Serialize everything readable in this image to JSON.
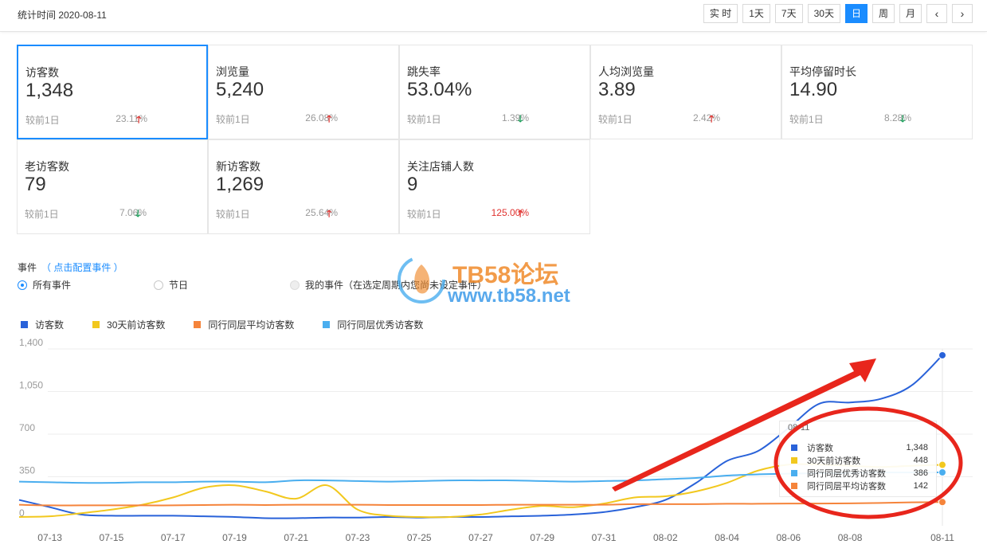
{
  "header": {
    "stat_time": "统计时间 2020-08-11",
    "ranges": [
      "实 时",
      "1天",
      "7天",
      "30天",
      "日",
      "周",
      "月"
    ],
    "active_range": "日",
    "prev_arrow": "‹",
    "next_arrow": "›"
  },
  "cards": [
    {
      "title": "访客数",
      "value": "1,348",
      "compare": "较前1日",
      "pct": "23.11%",
      "trend": "up"
    },
    {
      "title": "浏览量",
      "value": "5,240",
      "compare": "较前1日",
      "pct": "26.08%",
      "trend": "up"
    },
    {
      "title": "跳失率",
      "value": "53.04%",
      "compare": "较前1日",
      "pct": "1.39%",
      "trend": "down"
    },
    {
      "title": "人均浏览量",
      "value": "3.89",
      "compare": "较前1日",
      "pct": "2.42%",
      "trend": "up"
    },
    {
      "title": "平均停留时长",
      "value": "14.90",
      "compare": "较前1日",
      "pct": "8.28%",
      "trend": "down"
    },
    {
      "title": "老访客数",
      "value": "79",
      "compare": "较前1日",
      "pct": "7.06%",
      "trend": "down"
    },
    {
      "title": "新访客数",
      "value": "1,269",
      "compare": "较前1日",
      "pct": "25.64%",
      "trend": "up"
    },
    {
      "title": "关注店铺人数",
      "value": "9",
      "compare": "较前1日",
      "pct": "125.00%",
      "trend": "up",
      "pct_color": "red"
    }
  ],
  "events": {
    "title": "事件",
    "config_link": "（ 点击配置事件 ）",
    "options": [
      "所有事件",
      "节日",
      "我的事件（在选定周期内您尚未设定事件）"
    ]
  },
  "watermark": {
    "line1": "TB58论坛",
    "line2": "www.tb58.net"
  },
  "colors": {
    "visitors": "#2962d9",
    "visitors_30d": "#f2c81e",
    "peer_avg": "#f5843b",
    "peer_top": "#4aaeef",
    "accent": "#1a8cff"
  },
  "chart_data": {
    "type": "line",
    "x": [
      "07-12",
      "07-13",
      "07-14",
      "07-15",
      "07-16",
      "07-17",
      "07-18",
      "07-19",
      "07-20",
      "07-21",
      "07-22",
      "07-23",
      "07-24",
      "07-25",
      "07-26",
      "07-27",
      "07-28",
      "07-29",
      "07-30",
      "07-31",
      "08-01",
      "08-02",
      "08-03",
      "08-04",
      "08-05",
      "08-06",
      "08-07",
      "08-08",
      "08-09",
      "08-10",
      "08-11"
    ],
    "xticks": [
      "07-13",
      "07-15",
      "07-17",
      "07-19",
      "07-21",
      "07-23",
      "07-25",
      "07-27",
      "07-29",
      "07-31",
      "08-02",
      "08-04",
      "08-06",
      "08-08",
      "08-11"
    ],
    "yticks": [
      0,
      350,
      700,
      1050,
      1400
    ],
    "ylim": [
      0,
      1400
    ],
    "legend_position": "top-left",
    "series": [
      {
        "name": "访客数",
        "color": "#2962d9",
        "values": [
          160,
          100,
          40,
          30,
          30,
          30,
          25,
          20,
          10,
          10,
          15,
          15,
          20,
          15,
          20,
          20,
          25,
          30,
          40,
          60,
          100,
          160,
          300,
          480,
          560,
          750,
          950,
          960,
          990,
          1100,
          1348
        ]
      },
      {
        "name": "30天前访客数",
        "color": "#f2c81e",
        "values": [
          20,
          25,
          50,
          80,
          120,
          180,
          260,
          280,
          230,
          170,
          280,
          80,
          30,
          20,
          20,
          40,
          80,
          110,
          100,
          130,
          180,
          190,
          230,
          300,
          400,
          450,
          450,
          440,
          430,
          440,
          448
        ]
      },
      {
        "name": "同行同层平均访客数",
        "color": "#f5843b",
        "values": [
          120,
          115,
          115,
          115,
          115,
          115,
          118,
          120,
          118,
          120,
          120,
          120,
          118,
          118,
          118,
          118,
          120,
          120,
          120,
          120,
          125,
          125,
          125,
          128,
          128,
          130,
          130,
          132,
          135,
          140,
          142
        ]
      },
      {
        "name": "同行同层优秀访客数",
        "color": "#4aaeef",
        "values": [
          310,
          305,
          300,
          300,
          305,
          305,
          310,
          310,
          305,
          320,
          320,
          315,
          310,
          315,
          320,
          320,
          320,
          315,
          310,
          315,
          320,
          330,
          340,
          360,
          370,
          375,
          380,
          380,
          385,
          385,
          386
        ]
      }
    ],
    "tooltip": {
      "date": "08-11",
      "rows": [
        {
          "label": "访客数",
          "value": "1,348",
          "color": "#2962d9"
        },
        {
          "label": "30天前访客数",
          "value": "448",
          "color": "#f2c81e"
        },
        {
          "label": "同行同层优秀访客数",
          "value": "386",
          "color": "#4aaeef"
        },
        {
          "label": "同行同层平均访客数",
          "value": "142",
          "color": "#f5843b"
        }
      ]
    }
  }
}
